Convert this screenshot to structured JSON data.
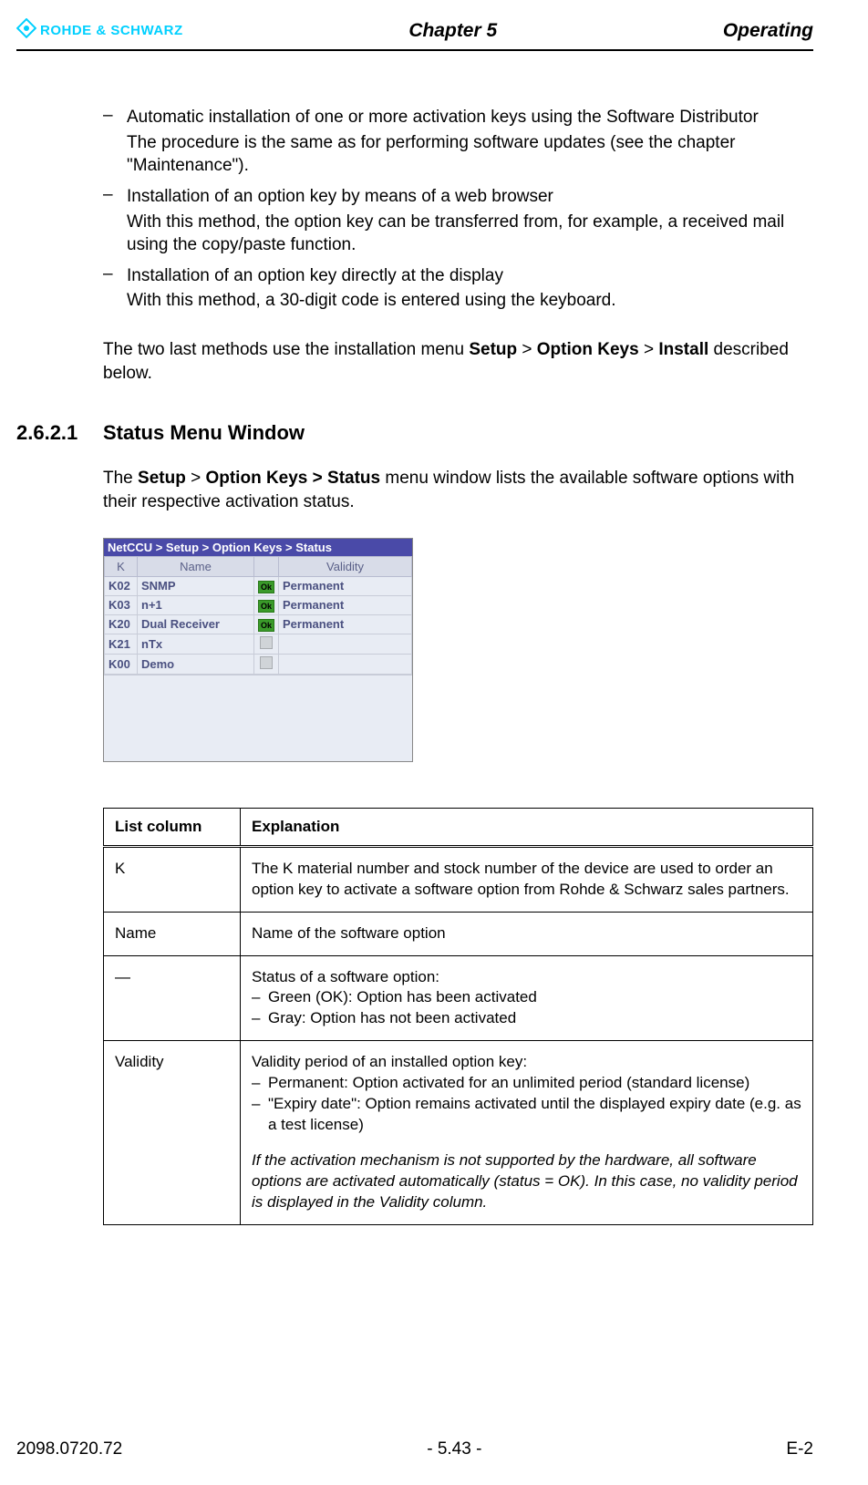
{
  "header": {
    "brand": "ROHDE & SCHWARZ",
    "chapter": "Chapter 5",
    "section": "Operating"
  },
  "bullets": [
    {
      "lead": "Automatic installation of one or more activation keys using the Software Distributor",
      "sub": "The procedure is the same as for performing software updates (see the chapter \"Maintenance\")."
    },
    {
      "lead": "Installation of an option key by means of a web browser",
      "sub": "With this method, the option key can be transferred from, for example, a received mail using the copy/paste function."
    },
    {
      "lead": "Installation of an option key directly at the display",
      "sub": "With this method, a 30-digit code is entered using the keyboard."
    }
  ],
  "para_nav_pre": "The two last methods use the installation menu ",
  "para_nav_b1": "Setup",
  "para_nav_sep": " > ",
  "para_nav_b2": "Option Keys",
  "para_nav_b3": "Install",
  "para_nav_post": " described below.",
  "heading": {
    "num": "2.6.2.1",
    "text": "Status Menu Window"
  },
  "intro_pre": "The ",
  "intro_b1": "Setup",
  "intro_sep": " > ",
  "intro_b2": "Option Keys > Status",
  "intro_post": " menu window lists the available software options with their respective activation status.",
  "screenshot": {
    "title": "NetCCU  > Setup > Option Keys > Status",
    "cols": {
      "k": "K",
      "name": "Name",
      "validity": "Validity"
    },
    "rows": [
      {
        "k": "K02",
        "name": "SNMP",
        "ok": true,
        "validity": "Permanent"
      },
      {
        "k": "K03",
        "name": "n+1",
        "ok": true,
        "validity": "Permanent"
      },
      {
        "k": "K20",
        "name": "Dual Receiver",
        "ok": true,
        "validity": "Permanent"
      },
      {
        "k": "K21",
        "name": "nTx",
        "ok": false,
        "validity": ""
      },
      {
        "k": "K00",
        "name": "Demo",
        "ok": false,
        "validity": ""
      }
    ],
    "ok_label": "Ok"
  },
  "table": {
    "h1": "List column",
    "h2": "Explanation",
    "rows": [
      {
        "c1": "K",
        "c2": "The K material number and stock number of the device are used to order an option key to activate a software option from Rohde & Schwarz sales partners."
      },
      {
        "c1": "Name",
        "c2": "Name of the software option"
      },
      {
        "c1": "—",
        "c2_lead": "Status of a software option:",
        "c2_items": [
          "Green (OK): Option has been activated",
          "Gray: Option has not been activated"
        ]
      },
      {
        "c1": "Validity",
        "c2_lead": "Validity period of an installed option key:",
        "c2_items": [
          "Permanent: Option activated for an unlimited period (standard license)",
          "\"Expiry date\": Option remains activated until the displayed expiry date (e.g. as a test license)"
        ],
        "note": "If the activation mechanism is not supported by the hardware, all software options are activated automatically (status = OK). In this case, no validity period is displayed in the Validity column."
      }
    ]
  },
  "footer": {
    "left": "2098.0720.72",
    "center": "- 5.43 -",
    "right": "E-2"
  }
}
